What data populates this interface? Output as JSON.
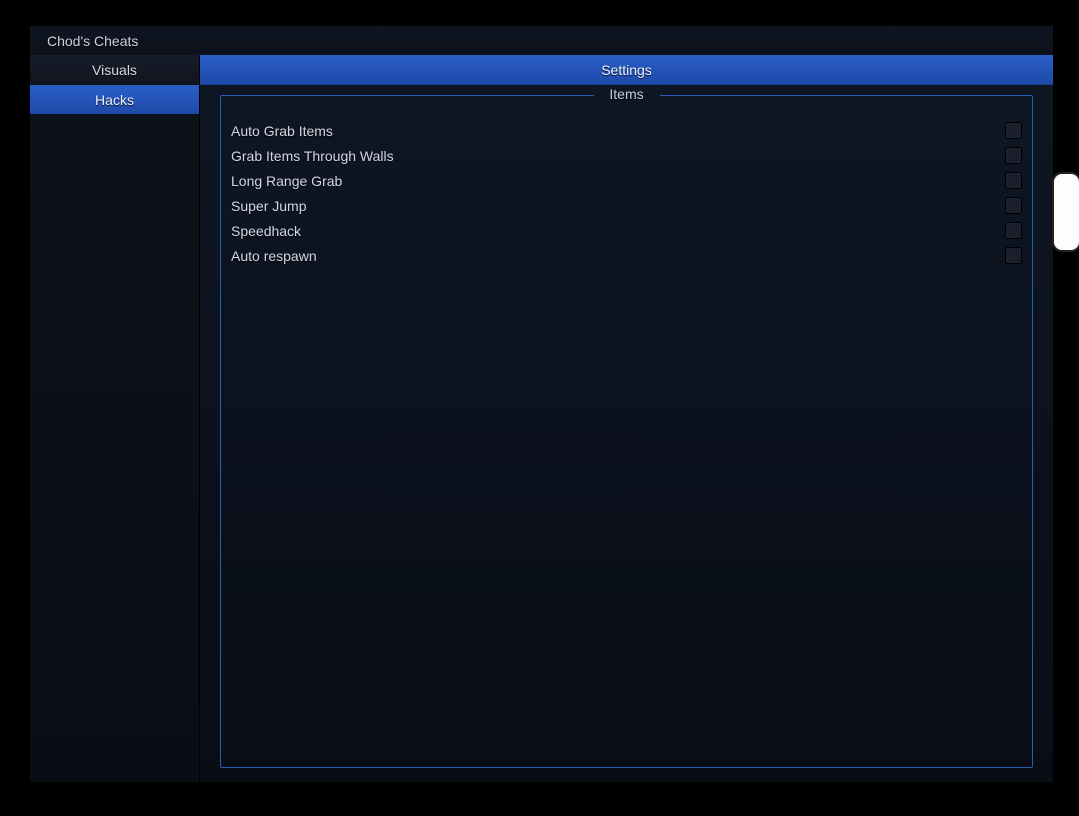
{
  "window": {
    "title": "Chod's Cheats"
  },
  "tabs": [
    {
      "label": "Visuals",
      "active": false
    },
    {
      "label": "Hacks",
      "active": true
    }
  ],
  "panel": {
    "title": "Settings",
    "group_label": "Items",
    "options": [
      {
        "label": "Auto Grab Items",
        "checked": false
      },
      {
        "label": "Grab Items Through Walls",
        "checked": false
      },
      {
        "label": "Long Range Grab",
        "checked": false
      },
      {
        "label": "Super Jump",
        "checked": false
      },
      {
        "label": "Speedhack",
        "checked": false
      },
      {
        "label": "Auto respawn",
        "checked": false
      }
    ]
  }
}
